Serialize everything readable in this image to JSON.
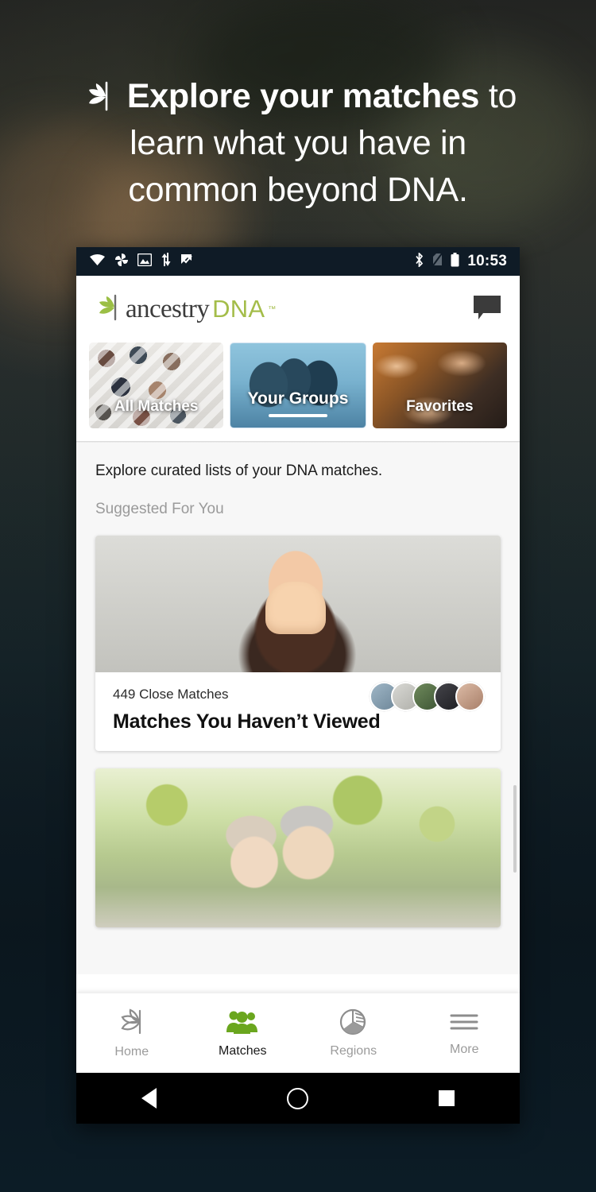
{
  "promo": {
    "line1_strong": "Explore your matches",
    "line1_rest": " to",
    "line2": "learn what you have in",
    "line3": "common beyond DNA.",
    "leaf_icon": "ancestry-leaf-icon"
  },
  "statusbar": {
    "time": "10:53",
    "left_icons": [
      "wifi-icon",
      "photos-pinwheel-icon",
      "image-icon",
      "sync-arrows-icon",
      "checkmark-flag-icon"
    ],
    "right_icons": [
      "bluetooth-icon",
      "no-sim-icon",
      "battery-icon"
    ]
  },
  "header": {
    "logo_primary": "ancestry",
    "logo_secondary": "DNA",
    "logo_tm": "™",
    "message_icon": "message-bubble-icon"
  },
  "tabs": [
    {
      "label": "All Matches",
      "selected": false
    },
    {
      "label": "Your Groups",
      "selected": true
    },
    {
      "label": "Favorites",
      "selected": false
    }
  ],
  "main": {
    "intro": "Explore curated lists of your DNA matches.",
    "section_title": "Suggested For You",
    "cards": [
      {
        "meta": "449 Close Matches",
        "title": "Matches You Haven’t Viewed",
        "avatar_count": 5,
        "avatar_colors": [
          "#8fa6b8",
          "#cfcfcb",
          "#5e7a52",
          "#2f2f33",
          "#caa692"
        ],
        "photo": "woman-covering-face-photo"
      },
      {
        "meta": "",
        "title": "",
        "avatar_count": 0,
        "photo": "senior-couple-laughing-photo"
      }
    ]
  },
  "bottom_nav": [
    {
      "label": "Home",
      "icon": "leaf-icon",
      "active": false
    },
    {
      "label": "Matches",
      "icon": "people-icon",
      "active": true
    },
    {
      "label": "Regions",
      "icon": "pie-chart-icon",
      "active": false
    },
    {
      "label": "More",
      "icon": "hamburger-menu-icon",
      "active": false
    }
  ],
  "android_nav": [
    {
      "label": "back",
      "icon": "back-triangle-icon"
    },
    {
      "label": "home",
      "icon": "home-circle-icon"
    },
    {
      "label": "recents",
      "icon": "recents-square-icon"
    }
  ],
  "colors": {
    "brand_green": "#a4bd4a",
    "active_green": "#6aa61e",
    "statusbar_bg": "#0f1b26",
    "page_bg": "#0d1f2a"
  }
}
